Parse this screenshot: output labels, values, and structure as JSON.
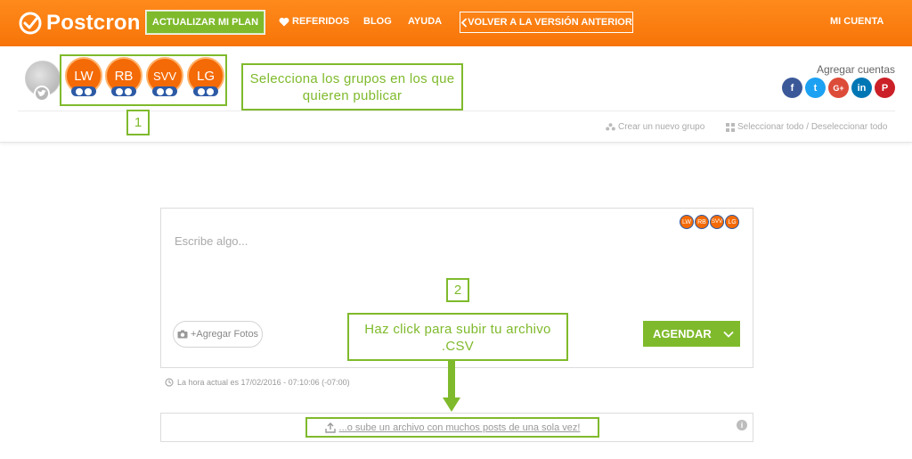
{
  "topbar": {
    "logo_text": "Postcron",
    "upgrade_label": "ACTUALIZAR MI PLAN",
    "nav": {
      "referidos": "REFERIDOS",
      "blog": "BLOG",
      "ayuda": "AYUDA",
      "volver": "VOLVER A LA VERSIÓN ANTERIOR",
      "cuenta": "MI CUENTA"
    }
  },
  "groups": {
    "items": [
      {
        "label": "LW"
      },
      {
        "label": "RB"
      },
      {
        "label": "SVV"
      },
      {
        "label": "LG"
      }
    ],
    "callout_text": "Selecciona los grupos en los que quieren publicar",
    "step_number": "1"
  },
  "accounts": {
    "label": "Agregar cuentas",
    "networks": [
      {
        "name": "facebook",
        "glyph": "f",
        "color": "#3b5998"
      },
      {
        "name": "twitter",
        "glyph": "t",
        "color": "#1da1f2"
      },
      {
        "name": "google-plus",
        "glyph": "G+",
        "color": "#dd4b39"
      },
      {
        "name": "linkedin",
        "glyph": "in",
        "color": "#0077b5"
      },
      {
        "name": "pinterest",
        "glyph": "P",
        "color": "#cb2027"
      }
    ]
  },
  "actions": {
    "crear_grupo": "Crear un nuevo grupo",
    "seleccionar": "Seleccionar todo / Deseleccionar todo"
  },
  "composer": {
    "placeholder": "Escribe algo...",
    "mini_groups": [
      "LW",
      "RB",
      "SVV",
      "LG"
    ],
    "step_number": "2",
    "fotos_label": "+Agregar Fotos",
    "callout_text": "Haz click para subir tu archivo .CSV",
    "agendar_label": "AGENDAR"
  },
  "hora_actual": "La hora actual es 17/02/2016 - 07:10:06 (-07:00)",
  "upload": {
    "link_text": "...o sube un archivo con muchos posts de una sola vez!",
    "info_glyph": "i"
  },
  "colors": {
    "brand_orange": "#f77408",
    "accent_green": "#7fba2c",
    "group_orange": "#f46a06"
  }
}
